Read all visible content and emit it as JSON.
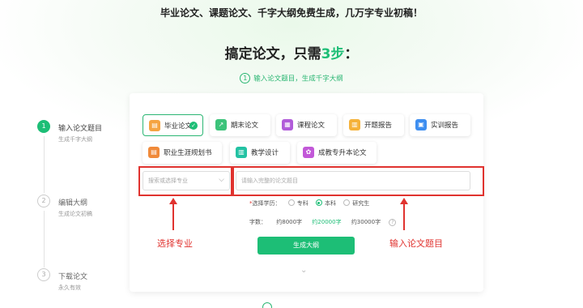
{
  "banner": "毕业论文、课题论文、千字大纲免费生成，几万字专业初稿！",
  "headline": {
    "prefix": "搞定论文，只需",
    "highlight": "3步",
    "suffix": "："
  },
  "step_hint": {
    "num": "1",
    "text": "输入论文题目，生成千字大纲"
  },
  "steps": [
    {
      "num": "1",
      "title": "输入论文题目",
      "sub": "生成千字大纲"
    },
    {
      "num": "2",
      "title": "编辑大纲",
      "sub": "生成论文初稿"
    },
    {
      "num": "3",
      "title": "下载论文",
      "sub": "永久有效"
    }
  ],
  "paper_types": [
    {
      "label": "毕业论文",
      "icon": "graduation-icon",
      "color": "#f5a442",
      "selected": true
    },
    {
      "label": "期末论文",
      "icon": "chart-icon",
      "color": "#3cc37a"
    },
    {
      "label": "课程论文",
      "icon": "book-icon",
      "color": "#b15bd9"
    },
    {
      "label": "开题报告",
      "icon": "document-icon",
      "color": "#f5b23a"
    },
    {
      "label": "实训报告",
      "icon": "report-icon",
      "color": "#3d8ef0"
    },
    {
      "label": "职业生涯规划书",
      "icon": "career-icon",
      "color": "#f08a3a"
    },
    {
      "label": "教学设计",
      "icon": "teaching-icon",
      "color": "#23c2a3"
    },
    {
      "label": "成教专升本论文",
      "icon": "degree-icon",
      "color": "#c258d8"
    }
  ],
  "major": {
    "placeholder": "搜索或选择专业"
  },
  "title_input": {
    "placeholder": "请输入完整的论文题目"
  },
  "education": {
    "required_mark": "*",
    "label": "选择学历：",
    "options": [
      "专科",
      "本科",
      "研究生"
    ],
    "selected": "本科"
  },
  "word_count": {
    "label": "字数：",
    "options": [
      "约8000字",
      "约20000字",
      "约30000字"
    ],
    "selected": "约20000字",
    "help": "?"
  },
  "generate_button": "生成大纲",
  "annotations": {
    "major": "选择专业",
    "title": "输入论文题目"
  },
  "colors": {
    "accent": "#1dbe76",
    "annotation": "#e0332f"
  }
}
